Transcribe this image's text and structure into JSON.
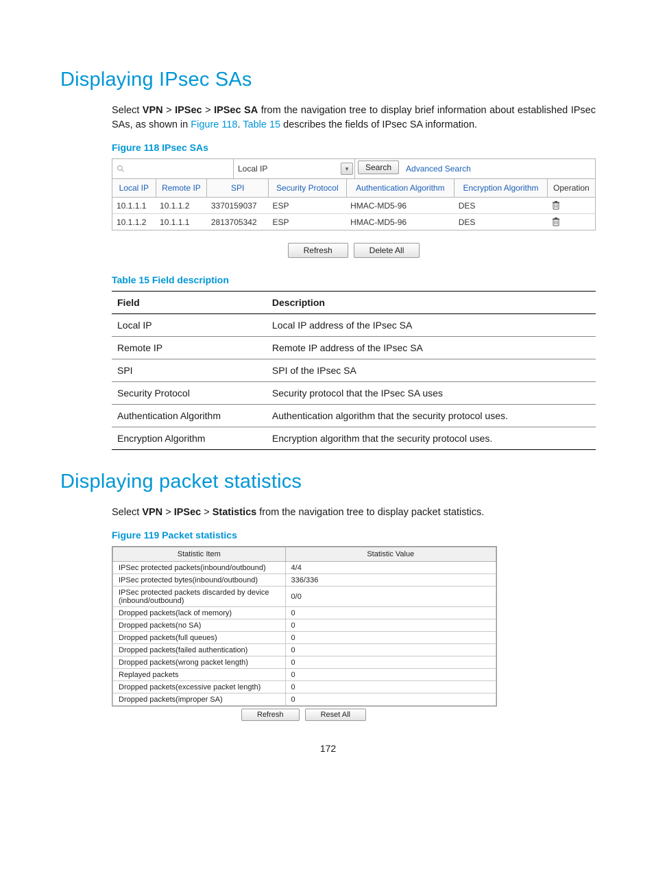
{
  "page_number": "172",
  "section1": {
    "heading": "Displaying IPsec SAs",
    "para_segments": [
      {
        "t": "Select ",
        "b": false,
        "l": false
      },
      {
        "t": "VPN",
        "b": true,
        "l": false
      },
      {
        "t": " > ",
        "b": false,
        "l": false
      },
      {
        "t": "IPSec",
        "b": true,
        "l": false
      },
      {
        "t": " > ",
        "b": false,
        "l": false
      },
      {
        "t": "IPSec SA",
        "b": true,
        "l": false
      },
      {
        "t": " from the navigation tree to display brief information about established IPsec SAs, as shown in ",
        "b": false,
        "l": false
      },
      {
        "t": "Figure 118",
        "b": false,
        "l": true
      },
      {
        "t": ". ",
        "b": false,
        "l": false
      },
      {
        "t": "Table 15",
        "b": false,
        "l": true
      },
      {
        "t": " describes the fields of IPsec SA information.",
        "b": false,
        "l": false
      }
    ],
    "figure_caption": "Figure 118 IPsec SAs",
    "search": {
      "dropdown_value": "Local IP",
      "search_btn": "Search",
      "advanced_link": "Advanced Search"
    },
    "sa_headers": [
      "Local IP",
      "Remote IP",
      "SPI",
      "Security Protocol",
      "Authentication Algorithm",
      "Encryption Algorithm",
      "Operation"
    ],
    "sa_rows": [
      {
        "local": "10.1.1.1",
        "remote": "10.1.1.2",
        "spi": "3370159037",
        "proto": "ESP",
        "auth": "HMAC-MD5-96",
        "enc": "DES"
      },
      {
        "local": "10.1.1.2",
        "remote": "10.1.1.1",
        "spi": "2813705342",
        "proto": "ESP",
        "auth": "HMAC-MD5-96",
        "enc": "DES"
      }
    ],
    "btn_refresh": "Refresh",
    "btn_delete_all": "Delete All",
    "table15_caption": "Table 15 Field description",
    "table15_headers": [
      "Field",
      "Description"
    ],
    "table15_rows": [
      {
        "f": "Local IP",
        "d": "Local IP address of the IPsec SA"
      },
      {
        "f": "Remote IP",
        "d": "Remote IP address of the IPsec SA"
      },
      {
        "f": "SPI",
        "d": "SPI of the IPsec SA"
      },
      {
        "f": "Security Protocol",
        "d": "Security protocol that the IPsec SA uses"
      },
      {
        "f": "Authentication Algorithm",
        "d": "Authentication algorithm that the security protocol uses."
      },
      {
        "f": "Encryption Algorithm",
        "d": "Encryption algorithm that the security protocol uses."
      }
    ]
  },
  "section2": {
    "heading": "Displaying packet statistics",
    "para_segments": [
      {
        "t": "Select ",
        "b": false,
        "l": false
      },
      {
        "t": "VPN",
        "b": true,
        "l": false
      },
      {
        "t": " > ",
        "b": false,
        "l": false
      },
      {
        "t": "IPSec",
        "b": true,
        "l": false
      },
      {
        "t": " > ",
        "b": false,
        "l": false
      },
      {
        "t": "Statistics",
        "b": true,
        "l": false
      },
      {
        "t": " from the navigation tree to display packet statistics.",
        "b": false,
        "l": false
      }
    ],
    "figure_caption": "Figure 119 Packet statistics",
    "stats_headers": [
      "Statistic Item",
      "Statistic Value"
    ],
    "stats_rows": [
      {
        "k": "IPSec protected packets(inbound/outbound)",
        "v": "4/4"
      },
      {
        "k": "IPSec protected bytes(inbound/outbound)",
        "v": "336/336"
      },
      {
        "k": "IPSec protected packets discarded by device (inbound/outbound)",
        "v": "0/0"
      },
      {
        "k": "Dropped packets(lack of memory)",
        "v": "0"
      },
      {
        "k": "Dropped packets(no SA)",
        "v": "0"
      },
      {
        "k": "Dropped packets(full queues)",
        "v": "0"
      },
      {
        "k": "Dropped packets(failed authentication)",
        "v": "0"
      },
      {
        "k": "Dropped packets(wrong packet length)",
        "v": "0"
      },
      {
        "k": "Replayed packets",
        "v": "0"
      },
      {
        "k": "Dropped packets(excessive packet length)",
        "v": "0"
      },
      {
        "k": "Dropped packets(improper SA)",
        "v": "0"
      }
    ],
    "btn_refresh": "Refresh",
    "btn_reset_all": "Reset All"
  }
}
